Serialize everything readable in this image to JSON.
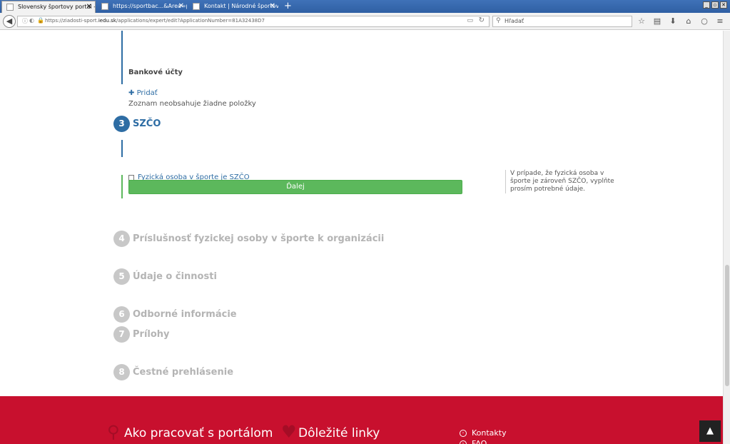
{
  "browser": {
    "tabs": [
      {
        "title": "Slovensky športovy portal - P..."
      },
      {
        "title": "https://sportbac...&Area=personlist"
      },
      {
        "title": "Kontakt | Národné športové centr..."
      }
    ],
    "url_prefix": "https://ziadosti-sport.",
    "url_domain": "iedu.sk",
    "url_path": "/applications/expert/edit?ApplicationNumber=81A32438D7",
    "search_placeholder": "Hľadať"
  },
  "section_bank": {
    "title": "Bankové účty",
    "add_label": "Pridať",
    "empty_text": "Zoznam neobsahuje žiadne položky"
  },
  "steps": [
    {
      "number": "3",
      "label": "SZČO",
      "active": true
    },
    {
      "number": "4",
      "label": "Príslušnosť fyzickej osoby v športe k organizácii"
    },
    {
      "number": "5",
      "label": "Údaje o činnosti"
    },
    {
      "number": "6",
      "label": "Odborné informácie"
    },
    {
      "number": "7",
      "label": "Prílohy"
    },
    {
      "number": "8",
      "label": "Čestné prehlásenie"
    }
  ],
  "szco": {
    "checkbox_label": "Fyzická osoba v športe je SZČO",
    "checked": false,
    "help_text": "V prípade, že fyzická osoba v športe je zároveň SZČO, vyplňte prosím potrebné údaje.",
    "next_label": "Ďalej"
  },
  "footer": {
    "col1": "Ako pracovať s portálom",
    "col2": "Dôležité linky",
    "links": [
      "Kontakty",
      "FAQ"
    ]
  },
  "colors": {
    "primary": "#2e6da4",
    "success": "#5cb85c",
    "footer": "#c8102e",
    "muted_step": "#c8c8c8"
  }
}
